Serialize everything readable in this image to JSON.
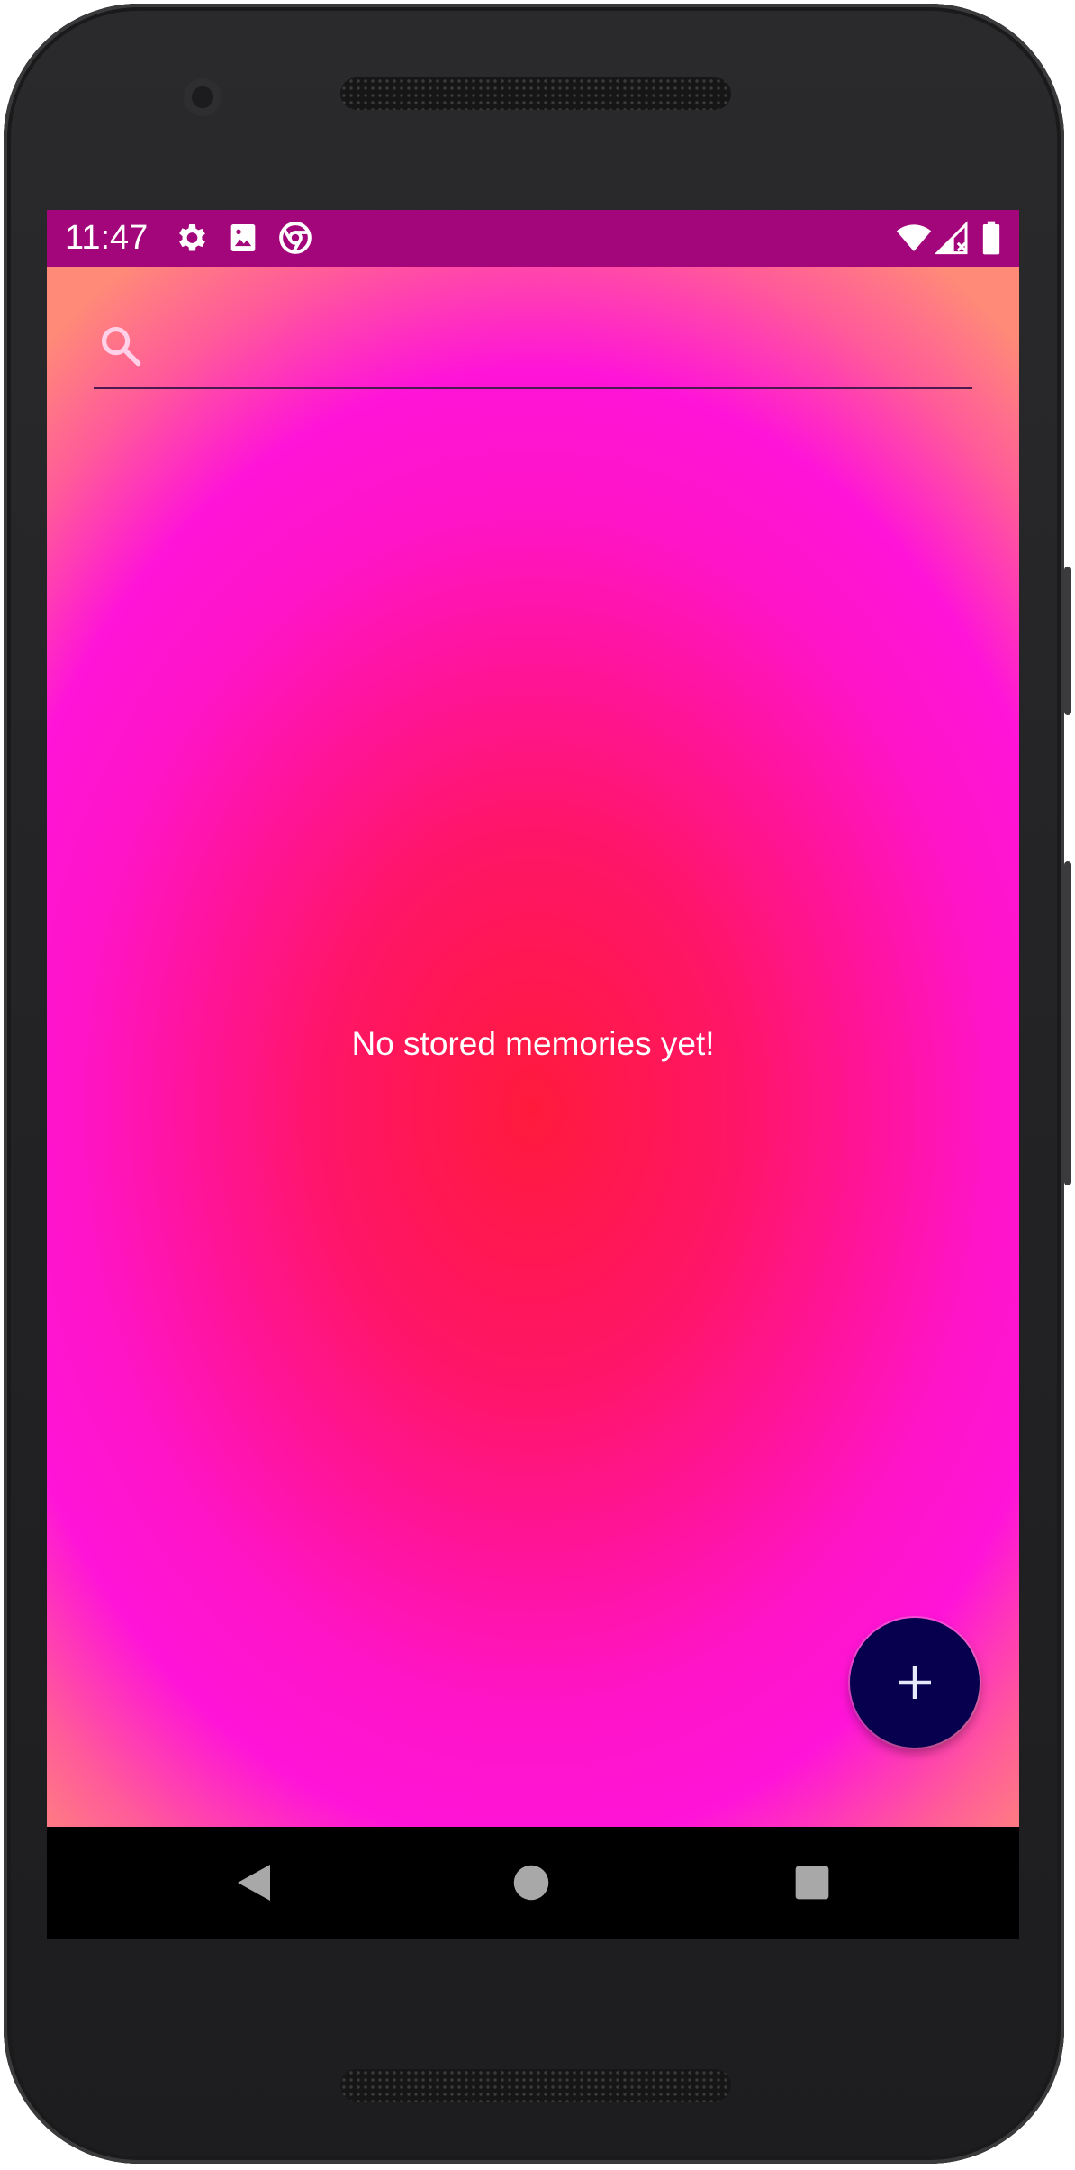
{
  "status_bar": {
    "time": "11:47",
    "left_icons": [
      "settings-icon",
      "image-icon",
      "chrome-icon"
    ],
    "right_icons": [
      "wifi-icon",
      "cell-signal-icon",
      "battery-icon"
    ],
    "background_color": "#a3057a"
  },
  "search": {
    "placeholder": "",
    "value": "",
    "icon": "search-icon"
  },
  "main": {
    "empty_message": "No stored memories yet!",
    "gradient_colors": [
      "#ff1a3c",
      "#ff14c8",
      "#ff8a78"
    ]
  },
  "fab": {
    "icon": "plus-icon",
    "color": "#06004e"
  },
  "nav_bar": {
    "buttons": [
      "back-icon",
      "home-icon",
      "recents-icon"
    ]
  }
}
